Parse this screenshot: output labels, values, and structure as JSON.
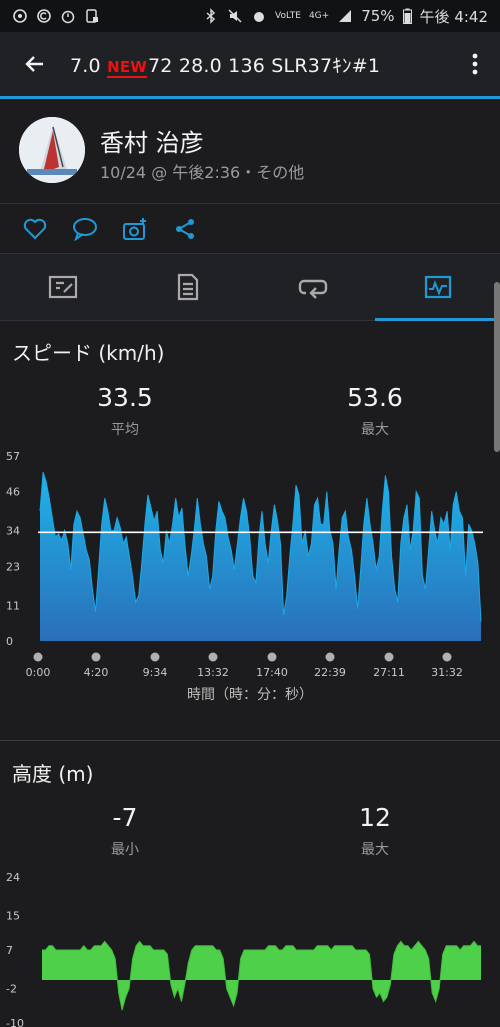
{
  "status": {
    "battery": "75%",
    "time": "午後 4:42",
    "network": "4G+"
  },
  "appbar": {
    "title_pre": "7.0 ",
    "new_badge": "NEW",
    "title_post": "72  28.0  136  SLR37ｷﾝ#1"
  },
  "profile": {
    "name": "香村 治彦",
    "meta": "10/24 @ 午後2:36・その他"
  },
  "icons": {
    "back": "back-arrow-icon",
    "more": "more-vert-icon",
    "like": "heart-icon",
    "comment": "comment-icon",
    "photo": "add-photo-icon",
    "share": "share-icon",
    "tab1": "summary-icon",
    "tab2": "details-icon",
    "tab3": "laps-icon",
    "tab4": "chart-icon"
  },
  "colors": {
    "accent": "#1e9ad6",
    "speed_fill": "#2a8fd1",
    "elev_fill": "#4fd04a"
  },
  "speed": {
    "title": "スピード (km/h)",
    "avg_value": "33.5",
    "avg_label": "平均",
    "max_value": "53.6",
    "max_label": "最大",
    "x_axis_label": "時間（時：分：秒）"
  },
  "elevation": {
    "title": "高度 (m)",
    "min_value": "-7",
    "min_label": "最小",
    "max_value": "12",
    "max_label": "最大"
  },
  "chart_data": [
    {
      "type": "area",
      "title": "スピード (km/h)",
      "y_ticks": [
        "57",
        "46",
        "34",
        "23",
        "11",
        "0"
      ],
      "ylim": [
        0,
        57
      ],
      "x_ticks": [
        "0:00",
        "4:20",
        "9:34",
        "13:32",
        "17:40",
        "22:39",
        "27:11",
        "31:32"
      ],
      "average_line": 33.5,
      "values": [
        40,
        52,
        49,
        44,
        38,
        32,
        33,
        31,
        34,
        30,
        22,
        36,
        40,
        38,
        33,
        28,
        25,
        16,
        9,
        22,
        36,
        44,
        40,
        34,
        34,
        38,
        35,
        30,
        32,
        26,
        20,
        12,
        14,
        24,
        36,
        45,
        41,
        37,
        40,
        28,
        24,
        34,
        30,
        36,
        44,
        38,
        41,
        30,
        20,
        26,
        34,
        44,
        36,
        30,
        26,
        16,
        20,
        34,
        43,
        40,
        38,
        32,
        28,
        22,
        30,
        38,
        44,
        40,
        32,
        20,
        18,
        32,
        40,
        30,
        24,
        34,
        42,
        37,
        30,
        8,
        14,
        26,
        36,
        48,
        45,
        30,
        34,
        26,
        30,
        42,
        44,
        36,
        36,
        46,
        34,
        30,
        16,
        28,
        38,
        40,
        32,
        28,
        20,
        10,
        22,
        36,
        44,
        36,
        30,
        22,
        26,
        40,
        51,
        46,
        26,
        16,
        12,
        30,
        38,
        42,
        28,
        34,
        46,
        44,
        20,
        16,
        28,
        40,
        34,
        30,
        38,
        36,
        40,
        28,
        42,
        46,
        40,
        38,
        20,
        36,
        34,
        30,
        24,
        6
      ]
    },
    {
      "type": "area",
      "title": "高度 (m)",
      "y_ticks": [
        "24",
        "15",
        "7",
        "-2",
        "-10"
      ],
      "ylim": [
        -10,
        24
      ],
      "values": [
        7,
        7,
        8,
        8,
        7,
        7,
        7,
        7,
        7,
        7,
        7,
        7,
        8,
        7,
        7,
        8,
        8,
        8,
        9,
        8,
        7,
        5,
        -3,
        -7,
        -4,
        -2,
        5,
        8,
        9,
        8,
        8,
        8,
        7,
        7,
        7,
        7,
        6,
        -1,
        -4,
        -2,
        -5,
        -1,
        4,
        7,
        8,
        8,
        8,
        8,
        8,
        8,
        7,
        7,
        5,
        -2,
        -4,
        -6,
        -3,
        5,
        7,
        7,
        7,
        7,
        7,
        7,
        7,
        8,
        8,
        8,
        7,
        7,
        8,
        8,
        8,
        7,
        7,
        7,
        7,
        7,
        7,
        8,
        8,
        8,
        8,
        7,
        8,
        8,
        8,
        8,
        8,
        8,
        7,
        7,
        7,
        7,
        6,
        -2,
        -4,
        -3,
        -5,
        -4,
        -1,
        6,
        8,
        9,
        8,
        8,
        7,
        8,
        9,
        8,
        7,
        5,
        -3,
        -5,
        -2,
        6,
        8,
        8,
        8,
        8,
        7,
        8,
        8,
        8,
        9,
        8,
        8
      ]
    }
  ]
}
